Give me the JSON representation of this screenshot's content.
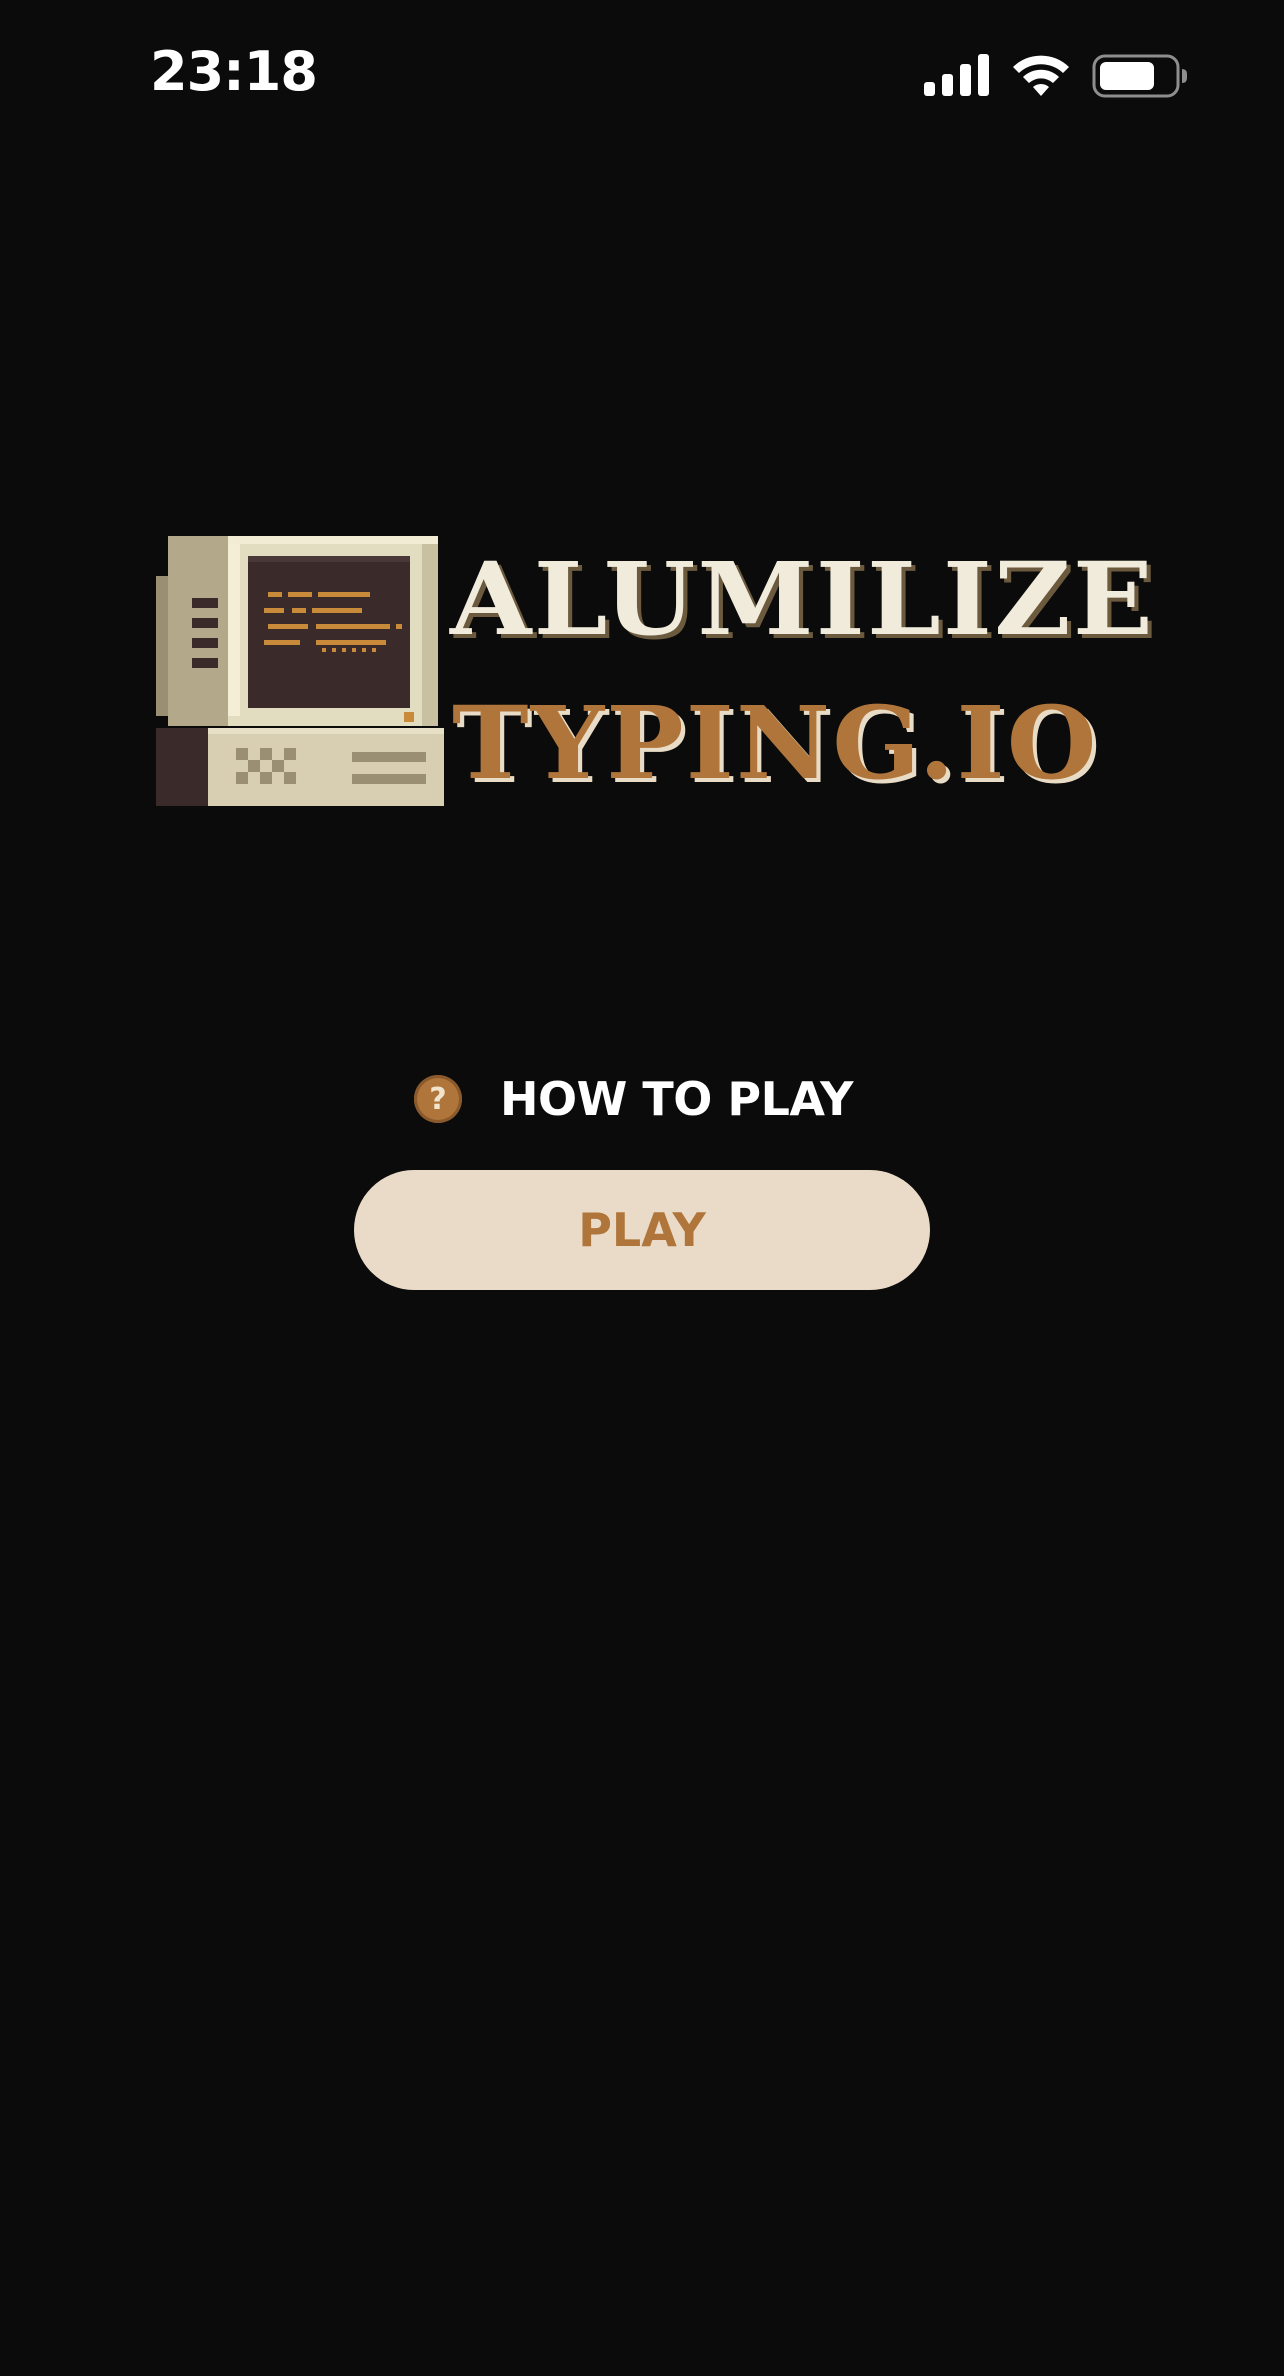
{
  "status_bar": {
    "time": "23:18",
    "icons": [
      "cellular-signal-icon",
      "wifi-icon",
      "battery-icon"
    ]
  },
  "logo": {
    "line1": "ALUMILIZE",
    "line2": "TYPING.IO",
    "colors": {
      "line1": "#f1ebdc",
      "line2": "#b0753a"
    }
  },
  "menu": {
    "how_to_play_label": "HOW TO PLAY",
    "how_to_play_icon": "question-mark-icon",
    "play_label": "PLAY"
  },
  "colors": {
    "background": "#0b0b0b",
    "accent": "#b0753a",
    "button_bg": "#eadbc8"
  }
}
